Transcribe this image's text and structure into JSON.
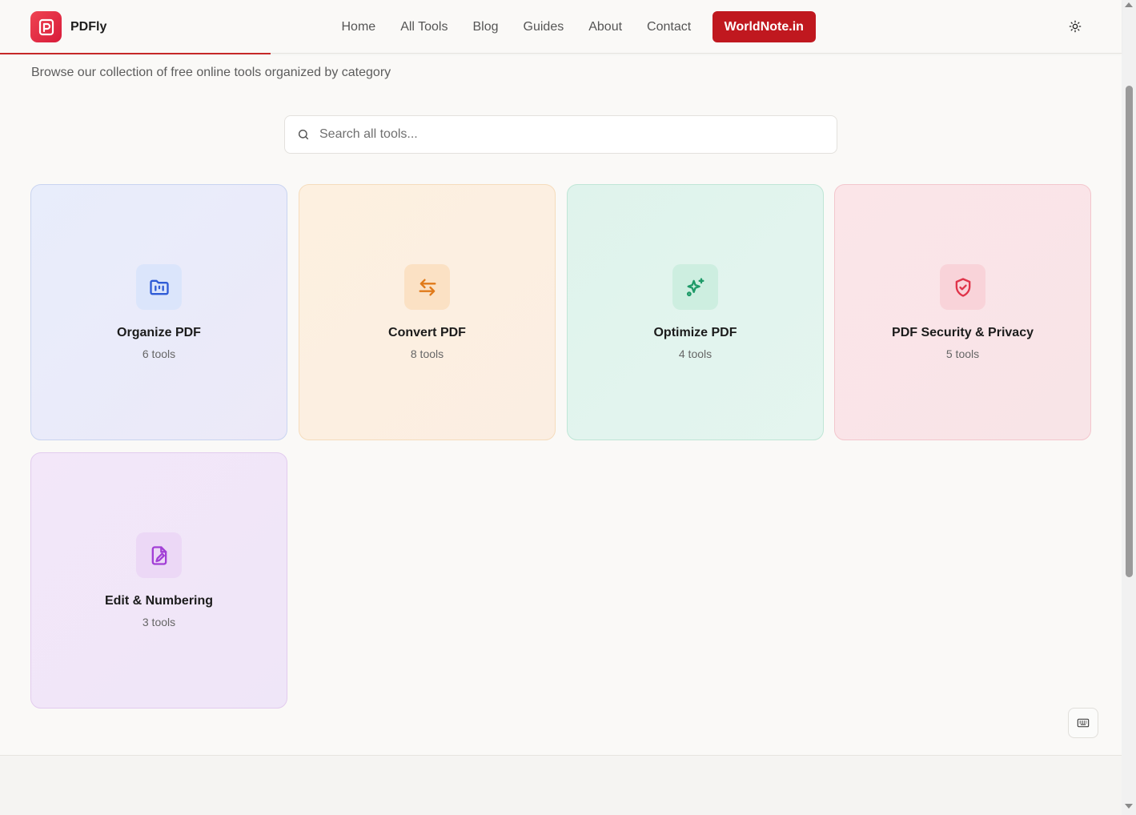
{
  "header": {
    "logo_text": "PDFly",
    "nav": [
      "Home",
      "All Tools",
      "Blog",
      "Guides",
      "About",
      "Contact"
    ],
    "cta_label": "WorldNote.in"
  },
  "subtitle": "Browse our collection of free online tools organized by category",
  "search": {
    "placeholder": "Search all tools..."
  },
  "categories": [
    {
      "title": "Organize PDF",
      "count": "6 tools",
      "icon": "folder-icon",
      "color": "#2f5bd6"
    },
    {
      "title": "Convert PDF",
      "count": "8 tools",
      "icon": "arrows-swap-icon",
      "color": "#e07a1a"
    },
    {
      "title": "Optimize PDF",
      "count": "4 tools",
      "icon": "sparkles-icon",
      "color": "#1e9a68"
    },
    {
      "title": "PDF Security & Privacy",
      "count": "5 tools",
      "icon": "shield-icon",
      "color": "#e0344a"
    },
    {
      "title": "Edit & Numbering",
      "count": "3 tools",
      "icon": "file-edit-icon",
      "color": "#a23fd6"
    }
  ],
  "colors": {
    "brand": "#c0181f",
    "accent_line": "#c62828"
  }
}
